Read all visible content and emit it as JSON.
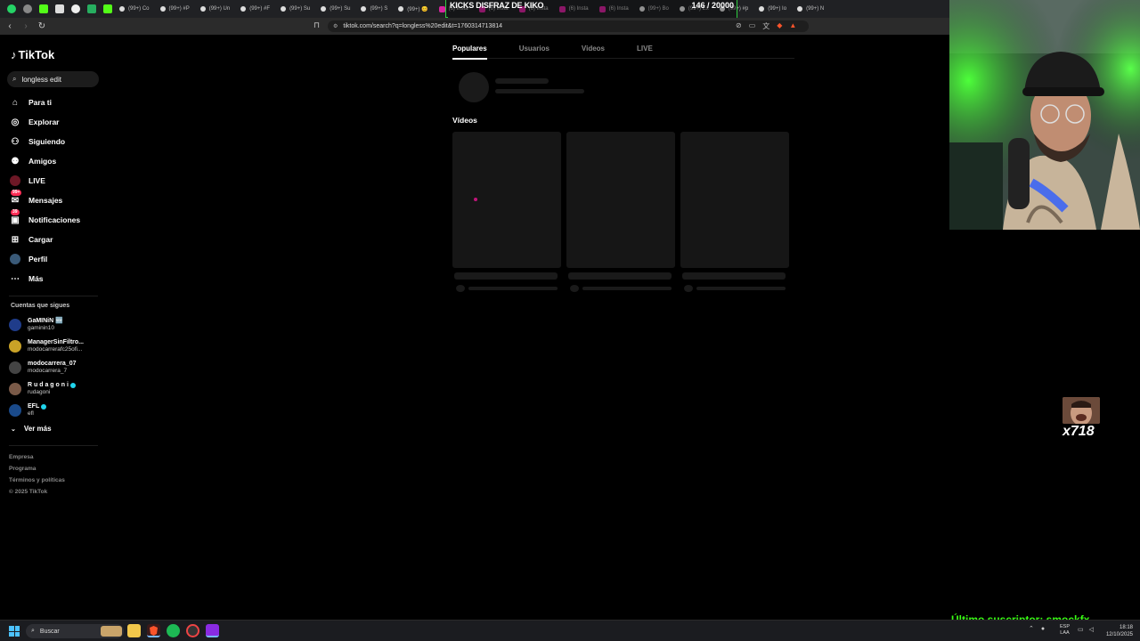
{
  "browser": {
    "tabs": [
      {
        "label": "(99+) Co",
        "icon": "tiktok-icon"
      },
      {
        "label": "(99+) #P",
        "icon": "tiktok-icon"
      },
      {
        "label": "(99+) Un",
        "icon": "tiktok-icon"
      },
      {
        "label": "(99+) #F",
        "icon": "tiktok-icon"
      },
      {
        "label": "(99+) Su",
        "icon": "tiktok-icon"
      },
      {
        "label": "(99+) Su",
        "icon": "tiktok-icon"
      },
      {
        "label": "(99+) S",
        "icon": "tiktok-icon"
      },
      {
        "label": "(99+) 😊",
        "icon": "tiktok-icon"
      },
      {
        "label": "(6) Insta",
        "icon": "instagram-icon"
      },
      {
        "label": "(6) Insta",
        "icon": "instagram-icon"
      },
      {
        "label": "(6) Insta",
        "icon": "instagram-icon"
      },
      {
        "label": "(6) Insta",
        "icon": "instagram-icon"
      },
      {
        "label": "(6) Insta",
        "icon": "instagram-icon"
      },
      {
        "label": "(99+) Bo",
        "icon": "tiktok-icon"
      },
      {
        "label": "(99+) Ex",
        "icon": "tiktok-icon"
      },
      {
        "label": "(99+) #p",
        "icon": "tiktok-icon"
      },
      {
        "label": "(99+) Io",
        "icon": "tiktok-icon"
      },
      {
        "label": "(99+) N",
        "icon": "tiktok-icon"
      }
    ],
    "url": "tiktok.com/search?q=longless%20edit&t=1760314713814"
  },
  "banner": {
    "title": "KICKS DISFRAZ DE KIKO",
    "count": "146 / 20000",
    "progress": 0.0073
  },
  "sidebar": {
    "logo": "TikTok",
    "search_value": "longless edit",
    "nav": [
      {
        "label": "Para ti",
        "icon": "home-icon",
        "name": "nav-para-ti"
      },
      {
        "label": "Explorar",
        "icon": "compass-icon",
        "name": "nav-explorar"
      },
      {
        "label": "Siguiendo",
        "icon": "user-follow-icon",
        "name": "nav-siguiendo"
      },
      {
        "label": "Amigos",
        "icon": "friends-icon",
        "name": "nav-amigos"
      },
      {
        "label": "LIVE",
        "icon": "live-icon",
        "name": "nav-live"
      },
      {
        "label": "Mensajes",
        "icon": "message-icon",
        "name": "nav-mensajes",
        "badge": "99+"
      },
      {
        "label": "Notificaciones",
        "icon": "bell-icon",
        "name": "nav-notificaciones",
        "badge": "39"
      },
      {
        "label": "Cargar",
        "icon": "upload-icon",
        "name": "nav-cargar"
      },
      {
        "label": "Perfil",
        "icon": "avatar-icon",
        "name": "nav-perfil"
      },
      {
        "label": "Más",
        "icon": "more-icon",
        "name": "nav-mas"
      }
    ],
    "following_title": "Cuentas que sigues",
    "following": [
      {
        "display": "GaMINiN 🆕",
        "handle": "gaminin10",
        "color": "#1f3c8a",
        "verified": false
      },
      {
        "display": "ManagerSinFiltro...",
        "handle": "modocarrerafc25ofi...",
        "color": "#c9a227",
        "verified": false
      },
      {
        "display": "modocarrera_07",
        "handle": "modocarrera_7",
        "color": "#444444",
        "verified": false
      },
      {
        "display": "R u d a g o n i",
        "handle": "rudagoni",
        "color": "#7a5a48",
        "verified": true
      },
      {
        "display": "EFL",
        "handle": "efl",
        "color": "#1a4a8a",
        "verified": true
      }
    ],
    "ver_mas": "Ver más",
    "footer": [
      "Empresa",
      "Programa",
      "Términos y políticas",
      "© 2025 TikTok"
    ]
  },
  "main": {
    "tabs": [
      "Populares",
      "Usuarios",
      "Videos",
      "LIVE"
    ],
    "active_tab": 0,
    "videos_heading": "Vídeos"
  },
  "overlay": {
    "emote_count": "x718",
    "last_sub": "Último suscriptor: smockfx"
  },
  "taskbar": {
    "search_placeholder": "Buscar",
    "lang_1": "ESP",
    "lang_2": "LAA",
    "time": "18:18",
    "date": "12/10/2025"
  }
}
